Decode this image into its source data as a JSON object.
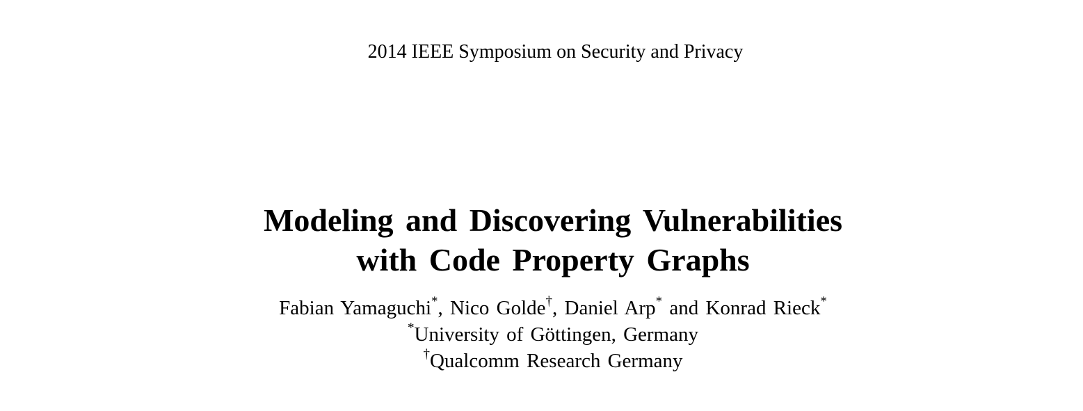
{
  "header": {
    "venue": "2014 IEEE Symposium on Security and Privacy"
  },
  "paper": {
    "title_line1": "Modeling and Discovering Vulnerabilities",
    "title_line2": "with Code Property Graphs",
    "authors": [
      {
        "name": "Fabian Yamaguchi",
        "mark": "*"
      },
      {
        "name": "Nico Golde",
        "mark": "†"
      },
      {
        "name": "Daniel Arp",
        "mark": "*"
      },
      {
        "name": "Konrad Rieck",
        "mark": "*"
      }
    ],
    "author_separators": [
      ", ",
      ", ",
      " and "
    ],
    "affiliations": [
      {
        "mark": "*",
        "name": "University of Göttingen, Germany"
      },
      {
        "mark": "†",
        "name": "Qualcomm Research Germany"
      }
    ]
  }
}
